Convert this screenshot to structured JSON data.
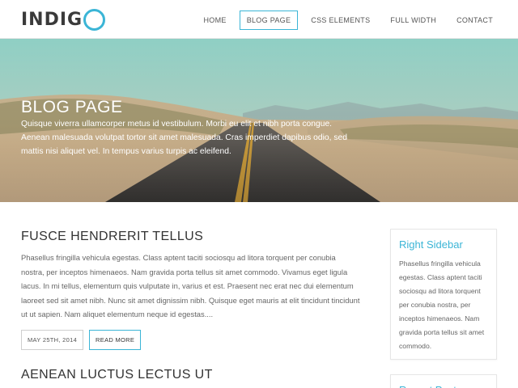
{
  "site": {
    "logo_text": "INDIG",
    "accent": "#3bb5d6"
  },
  "nav": {
    "items": [
      {
        "label": "HOME",
        "active": false
      },
      {
        "label": "BLOG PAGE",
        "active": true
      },
      {
        "label": "CSS ELEMENTS",
        "active": false
      },
      {
        "label": "FULL WIDTH",
        "active": false
      },
      {
        "label": "CONTACT",
        "active": false
      }
    ]
  },
  "hero": {
    "title": "BLOG PAGE",
    "text": "Quisque viverra ullamcorper metus id vestibulum. Morbi eu elit et nibh porta congue. Aenean malesuada volutpat tortor sit amet malesuada. Cras imperdiet dapibus odio, sed mattis nisi aliquet vel. In tempus varius turpis ac eleifend."
  },
  "posts": [
    {
      "title": "FUSCE HENDRERIT TELLUS",
      "body": "Phasellus fringilla vehicula egestas. Class aptent taciti sociosqu ad litora torquent per conubia nostra, per inceptos himenaeos. Nam gravida porta tellus sit amet commodo. Vivamus eget ligula lacus. In mi tellus, elementum quis vulputate in, varius et est. Praesent nec erat nec dui elementum laoreet sed sit amet nibh. Nunc sit amet dignissim nibh. Quisque eget mauris at elit tincidunt tincidunt ut ut sapien. Nam aliquet elementum neque id egestas....",
      "date": "MAY 25TH, 2014",
      "more_label": "READ MORE"
    },
    {
      "title": "AENEAN LUCTUS LECTUS UT"
    }
  ],
  "sidebar": {
    "widgets": [
      {
        "title": "Right Sidebar",
        "body": "Phasellus fringilla vehicula egestas. Class aptent taciti sociosqu ad litora torquent per conubia nostra, per inceptos himenaeos. Nam gravida porta tellus sit amet commodo."
      },
      {
        "title": "Recent Posts"
      }
    ]
  }
}
